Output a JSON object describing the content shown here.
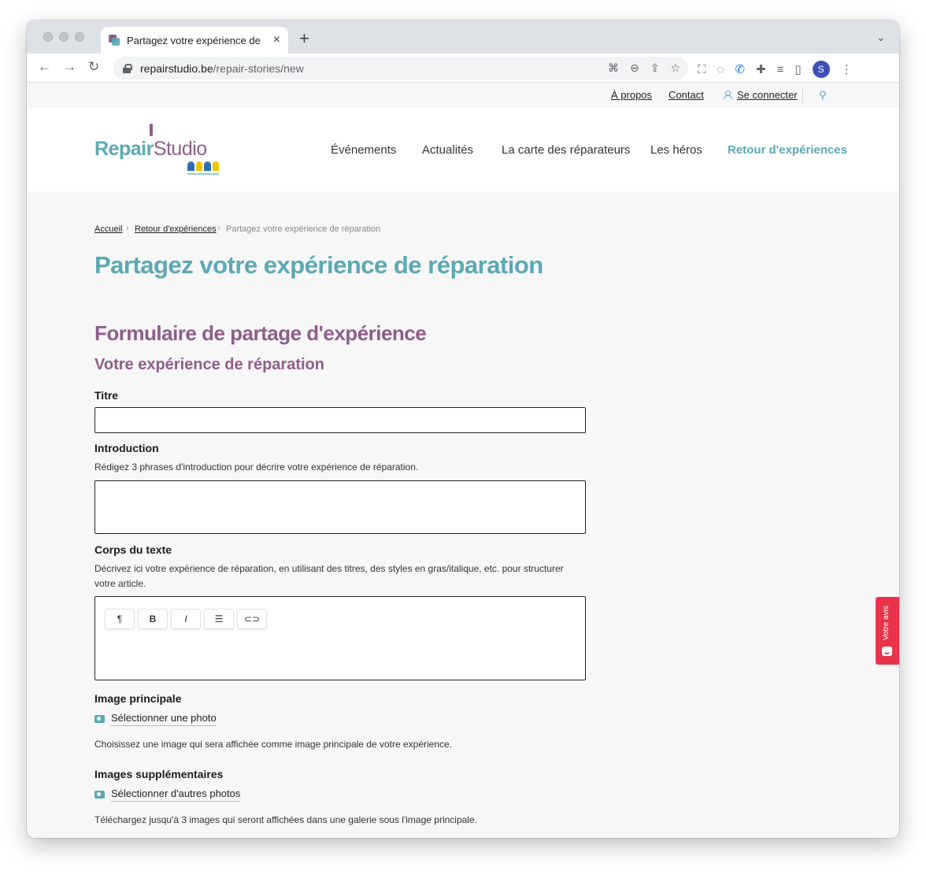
{
  "browser": {
    "tab_title": "Partagez votre expérience de réparation",
    "url_domain": "repairstudio.be",
    "url_path": "/repair-stories/new",
    "profile_initial": "S",
    "icons": [
      "back-icon",
      "forward-icon",
      "reload-icon",
      "lock-icon",
      "translate-icon",
      "zoom-icon",
      "share-icon",
      "bookmark-star-icon",
      "screenshot-icon",
      "eye-off-icon",
      "phone-icon",
      "extensions-icon",
      "media-icon",
      "side-panel-icon",
      "menu-dots-icon"
    ]
  },
  "topbar": {
    "apropos": "À propos",
    "contact": "Contact",
    "login": "Se connecter"
  },
  "logo": {
    "repair": "Repair",
    "studio": "Studio"
  },
  "nav": {
    "items": [
      {
        "label": "Événements"
      },
      {
        "label": "Actualités"
      },
      {
        "label": "La carte des réparateurs"
      },
      {
        "label": "Les héros"
      },
      {
        "label": "Retour d'expériences"
      }
    ]
  },
  "breadcrumb": {
    "home": "Accueil",
    "parent": "Retour d'expériences",
    "current": "Partagez votre expérience de réparation"
  },
  "page": {
    "title": "Partagez votre expérience de réparation",
    "form_title": "Formulaire de partage d'expérience",
    "section_title": "Votre expérience de réparation"
  },
  "form": {
    "titre_label": "Titre",
    "intro_label": "Introduction",
    "intro_help": "Rédigez 3 phrases d'introduction pour décrire votre expérience de réparation.",
    "body_label": "Corps du texte",
    "body_help": "Décrivez ici votre expérience de réparation, en utilisant des titres, des styles en gras/italique, etc. pour structurer votre article.",
    "editor_tools": {
      "paragraph": "¶",
      "bold": "B",
      "italic": "I",
      "list": "☰",
      "link": "⊂⊃"
    },
    "image_label": "Image principale",
    "image_link": "Sélectionner une photo",
    "image_help": "Choisissez une image qui sera affichée comme image principale de votre expérience.",
    "more_images_label": "Images supplémentaires",
    "more_images_link": "Sélectionner d'autres photos",
    "more_images_help": "Téléchargez jusqu'à 3 images qui seront affichées dans une galerie sous l'image principale."
  },
  "feedback": {
    "label": "Votre avis"
  },
  "colors": {
    "teal": "#5aa9b5",
    "plum": "#8f5d8c",
    "feedback_red": "#e8334a"
  }
}
